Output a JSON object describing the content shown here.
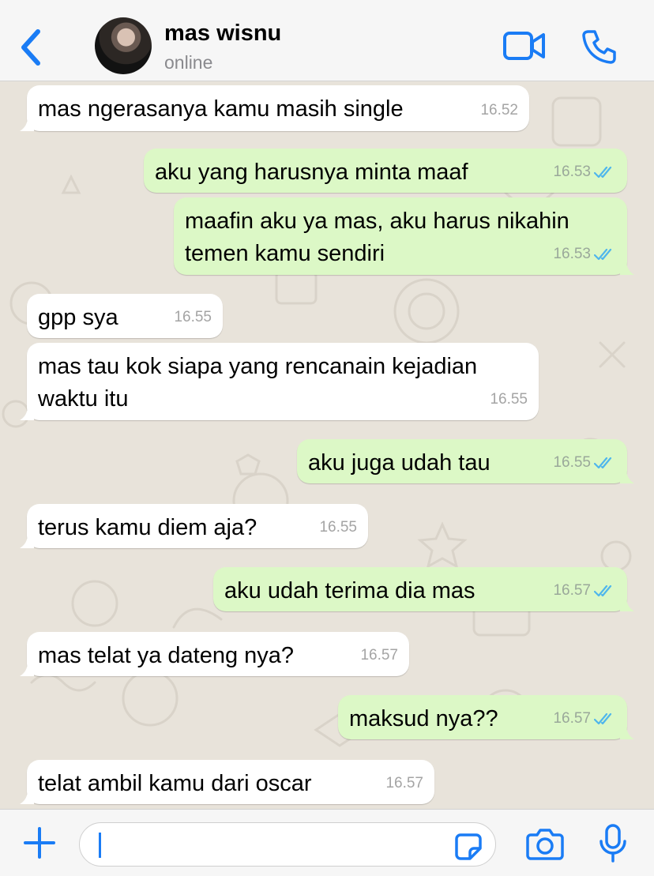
{
  "header": {
    "contact_name": "mas wisnu",
    "status": "online",
    "icons": [
      "chevron-left-icon",
      "video-camera-icon",
      "phone-icon"
    ]
  },
  "colors": {
    "accent": "#1a7cf5",
    "outgoing_bubble": "#dcf8c6",
    "incoming_bubble": "#ffffff",
    "read_ticks": "#4fb6ec"
  },
  "messages": [
    {
      "dir": "in",
      "lines": [
        "mas ngerasanya kamu masih single"
      ],
      "time": "16.52"
    },
    {
      "dir": "out",
      "lines": [
        "aku yang harusnya minta maaf"
      ],
      "time": "16.53",
      "read": true
    },
    {
      "dir": "out",
      "lines": [
        "maafin aku ya mas, aku harus nikahin",
        "temen kamu sendiri"
      ],
      "time": "16.53",
      "read": true
    },
    {
      "dir": "in",
      "lines": [
        "gpp sya"
      ],
      "time": "16.55"
    },
    {
      "dir": "in",
      "lines": [
        "mas tau kok siapa yang rencanain kejadian",
        "waktu itu"
      ],
      "time": "16.55"
    },
    {
      "dir": "out",
      "lines": [
        "aku juga udah tau"
      ],
      "time": "16.55",
      "read": true
    },
    {
      "dir": "in",
      "lines": [
        "terus kamu diem aja?"
      ],
      "time": "16.55"
    },
    {
      "dir": "out",
      "lines": [
        "aku udah terima dia mas"
      ],
      "time": "16.57",
      "read": true
    },
    {
      "dir": "in",
      "lines": [
        "mas telat ya dateng nya?"
      ],
      "time": "16.57"
    },
    {
      "dir": "out",
      "lines": [
        "maksud nya??"
      ],
      "time": "16.57",
      "read": true
    },
    {
      "dir": "in",
      "lines": [
        "telat ambil kamu dari oscar"
      ],
      "time": "16.57"
    }
  ],
  "composer": {
    "input_value": "",
    "icons": [
      "plus-icon",
      "sticker-icon",
      "camera-icon",
      "microphone-icon"
    ]
  }
}
